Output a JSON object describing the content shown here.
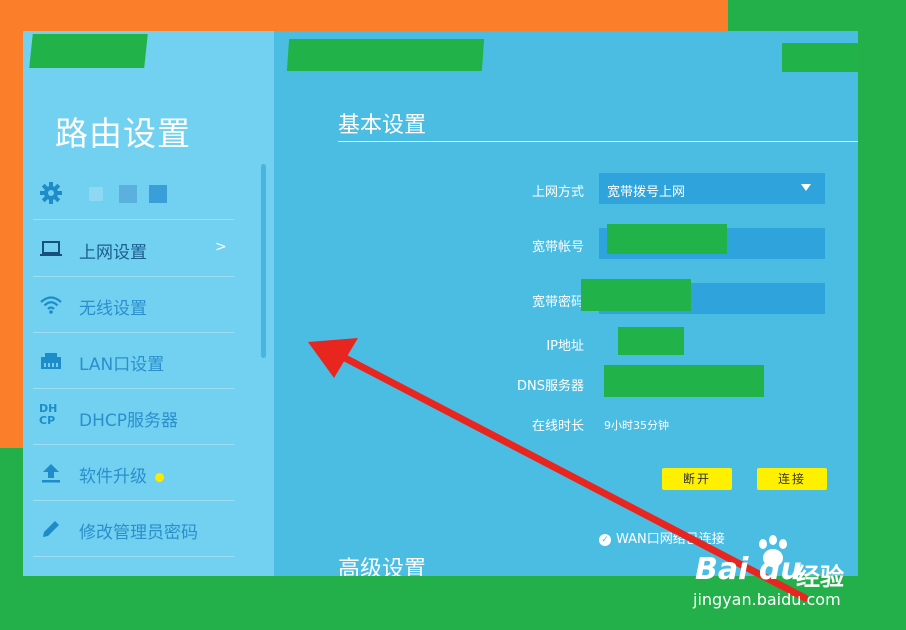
{
  "sidebar": {
    "title": "路由设置",
    "items": [
      {
        "label": "上网设置",
        "icon": "laptop-icon",
        "chevron": ">"
      },
      {
        "label": "无线设置",
        "icon": "wifi-icon"
      },
      {
        "label": "LAN口设置",
        "icon": "lan-port-icon"
      },
      {
        "label": "DHCP服务器",
        "icon": "dhcp-icon",
        "icon_text_top": "DH",
        "icon_text_bottom": "CP"
      },
      {
        "label": "软件升级",
        "icon": "upload-icon"
      },
      {
        "label": "修改管理员密码",
        "icon": "pencil-icon"
      }
    ]
  },
  "main": {
    "basic_title": "基本设置",
    "advanced_title": "高级设置",
    "fields": {
      "connection_type": {
        "label": "上网方式",
        "value": "宽带拨号上网"
      },
      "account": {
        "label": "宽带帐号"
      },
      "password": {
        "label": "宽带密码"
      },
      "ip": {
        "label": "IP地址"
      },
      "dns": {
        "label": "DNS服务器"
      },
      "uptime": {
        "label": "在线时长",
        "value": "9小时35分钟"
      }
    },
    "buttons": {
      "disconnect": "断开",
      "connect": "连接"
    },
    "status": "WAN口网络已连接"
  },
  "watermark": {
    "logo": "Bai du",
    "brand": "经验",
    "url": "jingyan.baidu.com"
  },
  "colors": {
    "accent_yellow": "#fff000",
    "annotation_arrow": "#e8251f",
    "redaction": "#21b34a"
  }
}
